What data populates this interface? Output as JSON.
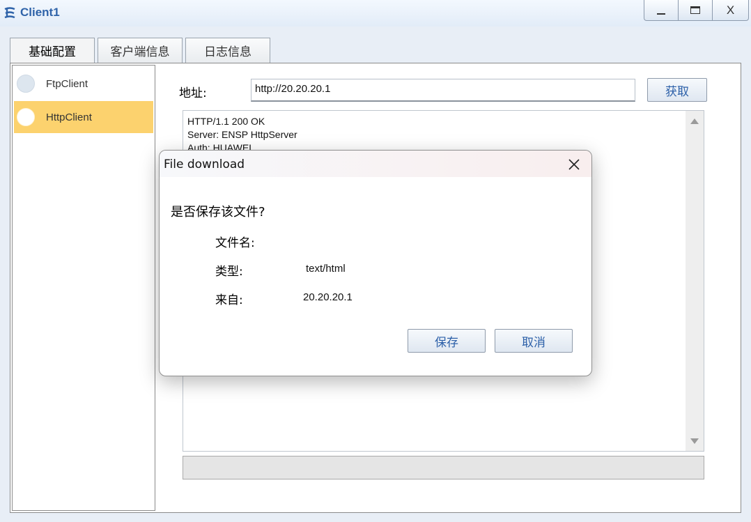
{
  "window": {
    "title": "Client1",
    "close_glyph": "X"
  },
  "tabs": [
    {
      "label": "基础配置",
      "active": true
    },
    {
      "label": "客户端信息",
      "active": false
    },
    {
      "label": "日志信息",
      "active": false
    }
  ],
  "sidebar": {
    "items": [
      {
        "label": "FtpClient",
        "selected": false
      },
      {
        "label": "HttpClient",
        "selected": true
      }
    ]
  },
  "address": {
    "label": "地址:",
    "value": "http://20.20.20.1",
    "fetch_label": "获取"
  },
  "response": {
    "lines": "HTTP/1.1 200 OK\nServer: ENSP HttpServer\nAuth: HUAWEI"
  },
  "dialog": {
    "title": "File download",
    "question": "是否保存该文件?",
    "filename_label": "文件名:",
    "filename_value": "",
    "type_label": "类型:",
    "type_value": "text/html",
    "from_label": "来自:",
    "from_value": "20.20.20.1",
    "save_label": "保存",
    "cancel_label": "取消"
  },
  "colors": {
    "accent_text": "#2b5fa8",
    "selected_item": "#fcd26e",
    "title_text": "#2f63a9"
  }
}
